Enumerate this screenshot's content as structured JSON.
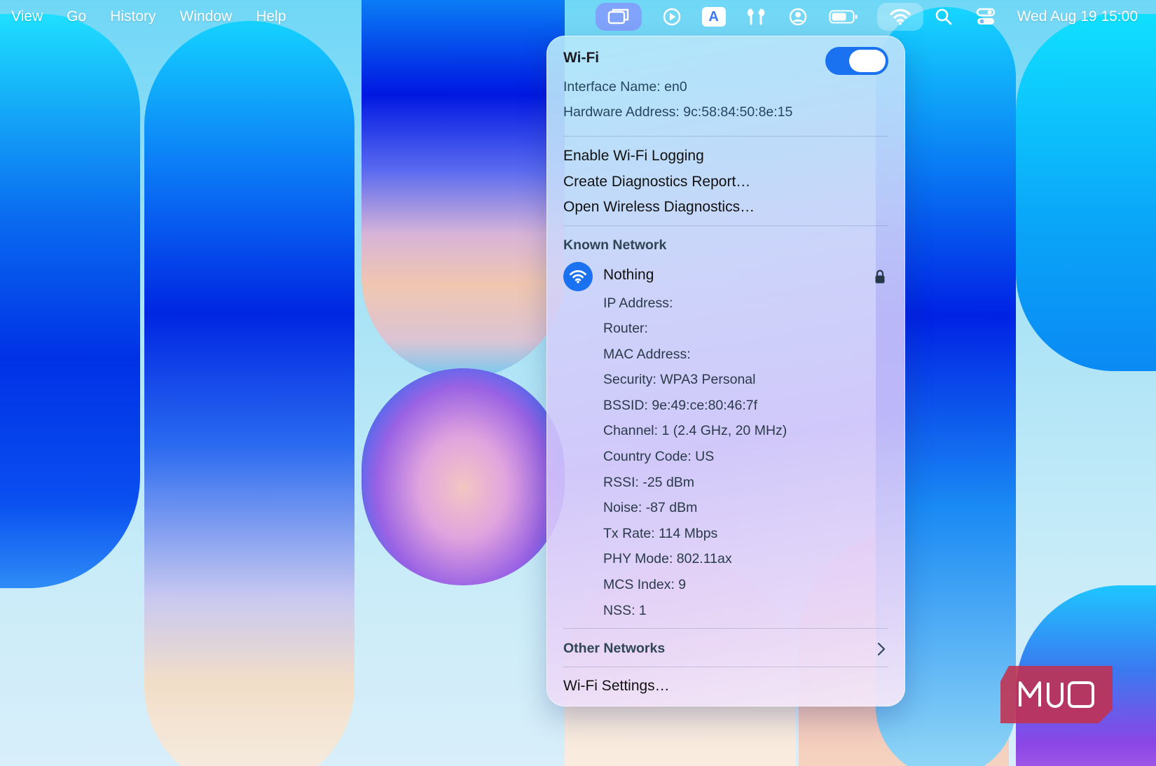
{
  "menubar": {
    "items": [
      "View",
      "Go",
      "History",
      "Window",
      "Help"
    ],
    "input_menu_letter": "A",
    "clock": "Wed Aug 19  15:00"
  },
  "wifi_panel": {
    "title": "Wi-Fi",
    "toggle_on": true,
    "interface_name": "Interface Name: en0",
    "hardware_address": "Hardware Address: 9c:58:84:50:8e:15",
    "options": [
      "Enable Wi-Fi Logging",
      "Create Diagnostics Report…",
      "Open Wireless Diagnostics…"
    ],
    "known_network_header": "Known Network",
    "network": {
      "name": "Nothing",
      "details": [
        "IP Address:",
        "Router:",
        "MAC Address:",
        "Security: WPA3 Personal",
        "BSSID: 9e:49:ce:80:46:7f",
        "Channel: 1 (2.4 GHz, 20 MHz)",
        "Country Code: US",
        "RSSI: -25 dBm",
        "Noise: -87 dBm",
        "Tx Rate: 114 Mbps",
        "PHY Mode: 802.11ax",
        "MCS Index: 9",
        "NSS: 1"
      ]
    },
    "other_networks": "Other Networks",
    "settings": "Wi-Fi Settings…"
  },
  "watermark": {
    "text": "MUO"
  },
  "colors": {
    "accent": "#1a72f0",
    "watermark": "#c2304e"
  }
}
